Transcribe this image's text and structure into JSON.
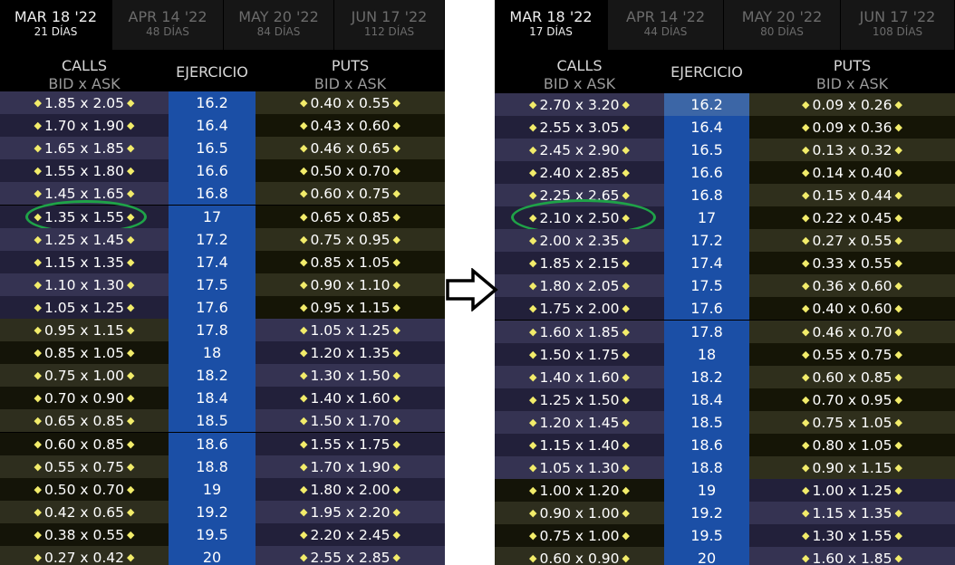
{
  "panels": [
    {
      "tabs": [
        {
          "date": "MAR 18 '22",
          "days": "21 DÍAS",
          "active": true
        },
        {
          "date": "APR 14 '22",
          "days": "48 DÍAS",
          "active": false
        },
        {
          "date": "MAY 20 '22",
          "days": "84 DÍAS",
          "active": false
        },
        {
          "date": "JUN 17 '22",
          "days": "112 DÍAS",
          "active": false
        }
      ],
      "headers": {
        "calls": "CALLS",
        "calls_sub": "BID x ASK",
        "strike": "EJERCICIO",
        "puts": "PUTS",
        "puts_sub": "BID x ASK"
      },
      "rows": [
        {
          "call": "1.85 x 2.05",
          "strike": "16.2",
          "put": "0.40 x 0.55",
          "itm": true
        },
        {
          "call": "1.70 x 1.90",
          "strike": "16.4",
          "put": "0.43 x 0.60",
          "itm": true
        },
        {
          "call": "1.65 x 1.85",
          "strike": "16.5",
          "put": "0.46 x 0.65",
          "itm": true
        },
        {
          "call": "1.55 x 1.80",
          "strike": "16.6",
          "put": "0.50 x 0.70",
          "itm": true
        },
        {
          "call": "1.45 x 1.65",
          "strike": "16.8",
          "put": "0.60 x 0.75",
          "itm": true
        },
        {
          "call": "1.35 x 1.55",
          "strike": "17",
          "put": "0.65 x 0.85",
          "itm": true,
          "highlight": true
        },
        {
          "call": "1.25 x 1.45",
          "strike": "17.2",
          "put": "0.75 x 0.95",
          "itm": true
        },
        {
          "call": "1.15 x 1.35",
          "strike": "17.4",
          "put": "0.85 x 1.05",
          "itm": true
        },
        {
          "call": "1.10 x 1.30",
          "strike": "17.5",
          "put": "0.90 x 1.10",
          "itm": true
        },
        {
          "call": "1.05 x 1.25",
          "strike": "17.6",
          "put": "0.95 x 1.15",
          "itm": true
        },
        {
          "call": "0.95 x 1.15",
          "strike": "17.8",
          "put": "1.05 x 1.25",
          "itm": false
        },
        {
          "call": "0.85 x 1.05",
          "strike": "18",
          "put": "1.20 x 1.35",
          "itm": false
        },
        {
          "call": "0.75 x 1.00",
          "strike": "18.2",
          "put": "1.30 x 1.50",
          "itm": false
        },
        {
          "call": "0.70 x 0.90",
          "strike": "18.4",
          "put": "1.40 x 1.60",
          "itm": false
        },
        {
          "call": "0.65 x 0.85",
          "strike": "18.5",
          "put": "1.50 x 1.70",
          "itm": false
        },
        {
          "call": "0.60 x 0.85",
          "strike": "18.6",
          "put": "1.55 x 1.75",
          "itm": false
        },
        {
          "call": "0.55 x 0.75",
          "strike": "18.8",
          "put": "1.70 x 1.90",
          "itm": false
        },
        {
          "call": "0.50 x 0.70",
          "strike": "19",
          "put": "1.80 x 2.00",
          "itm": false
        },
        {
          "call": "0.42 x 0.65",
          "strike": "19.2",
          "put": "1.95 x 2.20",
          "itm": false
        },
        {
          "call": "0.38 x 0.55",
          "strike": "19.5",
          "put": "2.20 x 2.45",
          "itm": false
        },
        {
          "call": "0.27 x 0.42",
          "strike": "20",
          "put": "2.55 x 2.85",
          "itm": false
        }
      ]
    },
    {
      "tabs": [
        {
          "date": "MAR 18 '22",
          "days": "17 DÍAS",
          "active": true
        },
        {
          "date": "APR 14 '22",
          "days": "44 DÍAS",
          "active": false
        },
        {
          "date": "MAY 20 '22",
          "days": "80 DÍAS",
          "active": false
        },
        {
          "date": "JUN 17 '22",
          "days": "108 DÍAS",
          "active": false
        }
      ],
      "headers": {
        "calls": "CALLS",
        "calls_sub": "BID x ASK",
        "strike": "EJERCICIO",
        "puts": "PUTS",
        "puts_sub": "BID x ASK"
      },
      "rows": [
        {
          "call": "2.70 x 3.20",
          "strike": "16.2",
          "put": "0.09 x 0.26",
          "itm": true,
          "selected": true
        },
        {
          "call": "2.55 x 3.05",
          "strike": "16.4",
          "put": "0.09 x 0.36",
          "itm": true
        },
        {
          "call": "2.45 x 2.90",
          "strike": "16.5",
          "put": "0.13 x 0.32",
          "itm": true
        },
        {
          "call": "2.40 x 2.85",
          "strike": "16.6",
          "put": "0.14 x 0.40",
          "itm": true
        },
        {
          "call": "2.25 x 2.65",
          "strike": "16.8",
          "put": "0.15 x 0.44",
          "itm": true
        },
        {
          "call": "2.10 x 2.50",
          "strike": "17",
          "put": "0.22 x 0.45",
          "itm": true,
          "highlight": true
        },
        {
          "call": "2.00 x 2.35",
          "strike": "17.2",
          "put": "0.27 x 0.55",
          "itm": true
        },
        {
          "call": "1.85 x 2.15",
          "strike": "17.4",
          "put": "0.33 x 0.55",
          "itm": true
        },
        {
          "call": "1.80 x 2.05",
          "strike": "17.5",
          "put": "0.36 x 0.60",
          "itm": true
        },
        {
          "call": "1.75 x 2.00",
          "strike": "17.6",
          "put": "0.40 x 0.60",
          "itm": true
        },
        {
          "call": "1.60 x 1.85",
          "strike": "17.8",
          "put": "0.46 x 0.70",
          "itm": true
        },
        {
          "call": "1.50 x 1.75",
          "strike": "18",
          "put": "0.55 x 0.75",
          "itm": true
        },
        {
          "call": "1.40 x 1.60",
          "strike": "18.2",
          "put": "0.60 x 0.85",
          "itm": true
        },
        {
          "call": "1.25 x 1.50",
          "strike": "18.4",
          "put": "0.70 x 0.95",
          "itm": true
        },
        {
          "call": "1.20 x 1.45",
          "strike": "18.5",
          "put": "0.75 x 1.05",
          "itm": true
        },
        {
          "call": "1.15 x 1.40",
          "strike": "18.6",
          "put": "0.80 x 1.05",
          "itm": true
        },
        {
          "call": "1.05 x 1.30",
          "strike": "18.8",
          "put": "0.90 x 1.15",
          "itm": true
        },
        {
          "call": "1.00 x 1.20",
          "strike": "19",
          "put": "1.00 x 1.25",
          "itm": false
        },
        {
          "call": "0.90 x 1.00",
          "strike": "19.2",
          "put": "1.15 x 1.35",
          "itm": false
        },
        {
          "call": "0.75 x 1.00",
          "strike": "19.5",
          "put": "1.30 x 1.55",
          "itm": false
        },
        {
          "call": "0.60 x 0.90",
          "strike": "20",
          "put": "1.60 x 1.85",
          "itm": false
        }
      ]
    }
  ],
  "colors": {
    "itm_call_a": "#353352",
    "itm_call_b": "#22203a",
    "otm_call_a": "#2e2e1e",
    "otm_call_b": "#141408",
    "itm_put_a": "#353352",
    "itm_put_b": "#22203a",
    "otm_put_a": "#2f2f1c",
    "otm_put_b": "#151506",
    "strike": "#1b4fa6",
    "strike_selected": "#3c66a6",
    "dot": "#f2ec6a",
    "highlight_ring": "#1fa348"
  },
  "icons": {
    "transition": "right-arrow-icon",
    "bid_ask_marker": "diamond-dot-icon"
  }
}
